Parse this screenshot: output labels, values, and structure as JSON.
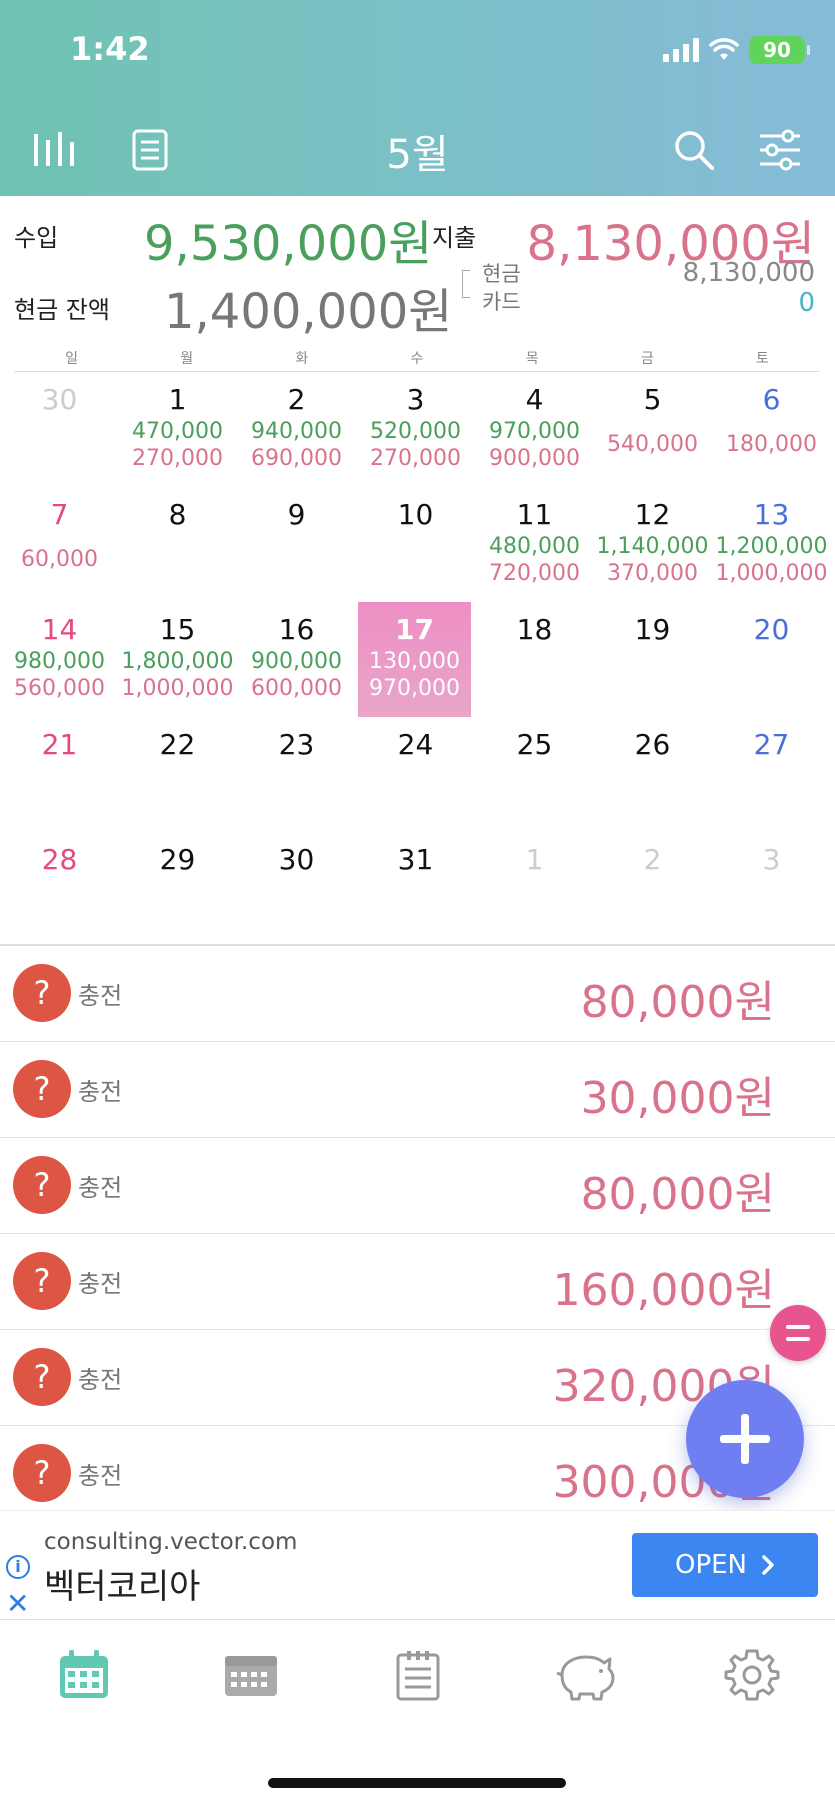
{
  "status": {
    "time": "1:42",
    "battery": "90"
  },
  "header": {
    "title": "5월"
  },
  "summary": {
    "income_label": "수입",
    "income": "9,530,000원",
    "expense_label": "지출",
    "expense": "8,130,000원",
    "balance_label": "현금 잔액",
    "balance": "1,400,000원",
    "cash_label": "현금",
    "cash_value": "8,130,000",
    "card_label": "카드",
    "card_value": "0"
  },
  "weekdays": [
    "일",
    "월",
    "화",
    "수",
    "목",
    "금",
    "토"
  ],
  "calendar": {
    "weeks": [
      [
        {
          "day": "30",
          "other": true
        },
        {
          "day": "1",
          "inc": "470,000",
          "exp": "270,000"
        },
        {
          "day": "2",
          "inc": "940,000",
          "exp": "690,000"
        },
        {
          "day": "3",
          "inc": "520,000",
          "exp": "270,000"
        },
        {
          "day": "4",
          "inc": "970,000",
          "exp": "900,000"
        },
        {
          "day": "5",
          "exp": "540,000"
        },
        {
          "day": "6",
          "exp": "180,000"
        }
      ],
      [
        {
          "day": "7",
          "exp": "60,000"
        },
        {
          "day": "8"
        },
        {
          "day": "9"
        },
        {
          "day": "10"
        },
        {
          "day": "11",
          "inc": "480,000",
          "exp": "720,000"
        },
        {
          "day": "12",
          "inc": "1,140,000",
          "exp": "370,000"
        },
        {
          "day": "13",
          "inc": "1,200,000",
          "exp": "1,000,000"
        }
      ],
      [
        {
          "day": "14",
          "inc": "980,000",
          "exp": "560,000"
        },
        {
          "day": "15",
          "inc": "1,800,000",
          "exp": "1,000,000"
        },
        {
          "day": "16",
          "inc": "900,000",
          "exp": "600,000"
        },
        {
          "day": "17",
          "inc": "130,000",
          "exp": "970,000",
          "today": true
        },
        {
          "day": "18"
        },
        {
          "day": "19"
        },
        {
          "day": "20"
        }
      ],
      [
        {
          "day": "21"
        },
        {
          "day": "22"
        },
        {
          "day": "23"
        },
        {
          "day": "24"
        },
        {
          "day": "25"
        },
        {
          "day": "26"
        },
        {
          "day": "27"
        }
      ],
      [
        {
          "day": "28"
        },
        {
          "day": "29"
        },
        {
          "day": "30"
        },
        {
          "day": "31"
        },
        {
          "day": "1",
          "other": true
        },
        {
          "day": "2",
          "other": true
        },
        {
          "day": "3",
          "other": true
        }
      ]
    ]
  },
  "transactions": [
    {
      "icon": "?",
      "label": "충전",
      "amount": "80,000원"
    },
    {
      "icon": "?",
      "label": "충전",
      "amount": "30,000원"
    },
    {
      "icon": "?",
      "label": "충전",
      "amount": "80,000원"
    },
    {
      "icon": "?",
      "label": "충전",
      "amount": "160,000원"
    },
    {
      "icon": "?",
      "label": "충전",
      "amount": "320,000원"
    },
    {
      "icon": "?",
      "label": "충전",
      "amount": "300,000원"
    }
  ],
  "ad": {
    "url": "consulting.vector.com",
    "name": "벡터코리아",
    "open_label": "OPEN",
    "info": "i",
    "close": "✕"
  },
  "tabs": [
    "calendar-icon",
    "week-calendar-icon",
    "list-icon",
    "piggy-bank-icon",
    "gear-icon"
  ],
  "colors": {
    "accent": "#6fc3b2",
    "income": "#4a9f5d",
    "expense": "#d9738b",
    "today": "#ee8fc4",
    "fab": "#6f7ff2"
  }
}
